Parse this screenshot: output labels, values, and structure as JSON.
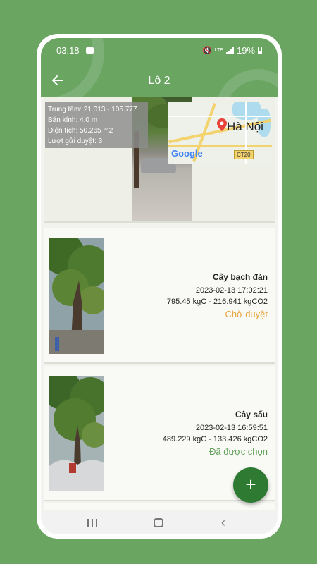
{
  "status_bar": {
    "time": "03:18",
    "network": "LTE",
    "battery": "19%"
  },
  "appbar": {
    "title": "Lô 2"
  },
  "header": {
    "info_lines": [
      "Trung tâm: 21.013 - 105.777",
      "Bán kính: 4.0 m",
      "Diện tích: 50.265 m2",
      "Lượt gửi duyệt: 3"
    ],
    "map": {
      "city": "Hà Nội",
      "logo": "Google",
      "road_badge": "CT20"
    }
  },
  "trees": [
    {
      "name": "Cây bạch đàn",
      "timestamp": "2023-02-13 17:02:21",
      "carbon": "795.45 kgC - 216.941 kgCO2",
      "status": "Chờ duyệt",
      "status_color": "#e8a33a"
    },
    {
      "name": "Cây sấu",
      "timestamp": "2023-02-13 16:59:51",
      "carbon": "489.229 kgC - 133.426 kgCO2",
      "status": "Đã được chọn",
      "status_color": "#5f9e57"
    }
  ],
  "fab": {
    "label": "+"
  },
  "colors": {
    "primary": "#6aa562",
    "fab": "#2e7a33"
  }
}
